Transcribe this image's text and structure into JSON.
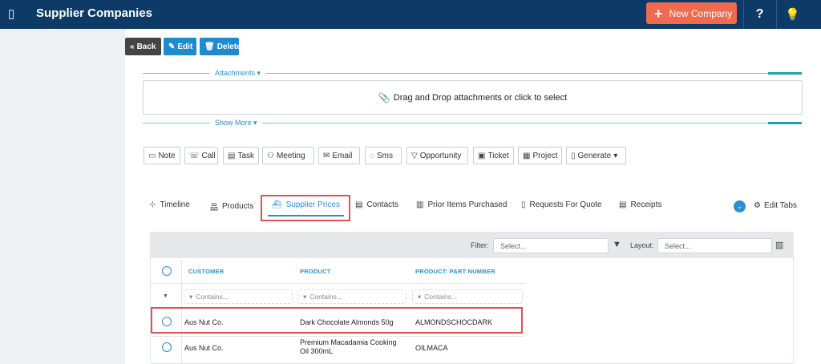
{
  "header": {
    "title": "Supplier Companies",
    "new_company_label": "New Company",
    "help_label": "?",
    "colors": {
      "bar": "#0d3a66",
      "new_company": "#f06a4f"
    }
  },
  "record_buttons": {
    "back": "Back",
    "edit": "Edit",
    "delete": "Delete"
  },
  "attachments": {
    "section_label": "Attachments",
    "dropzone_text": "Drag and Drop attachments or click to select",
    "show_more_label": "Show More"
  },
  "actions": [
    {
      "label": "Note",
      "icon": "note-icon"
    },
    {
      "label": "Call",
      "icon": "phone-icon"
    },
    {
      "label": "Task",
      "icon": "clipboard-icon"
    },
    {
      "label": "Meeting",
      "icon": "users-icon"
    },
    {
      "label": "Email",
      "icon": "email-icon"
    },
    {
      "label": "Sms",
      "icon": "chat-icon"
    },
    {
      "label": "Opportunity",
      "icon": "filter-icon"
    },
    {
      "label": "Ticket",
      "icon": "ticket-icon"
    },
    {
      "label": "Project",
      "icon": "project-icon"
    },
    {
      "label": "Generate",
      "icon": "document-icon"
    }
  ],
  "tabs": {
    "items": [
      "Timeline",
      "Products",
      "Supplier Prices",
      "Contacts",
      "Prior Items Purchased",
      "Requests For Quote",
      "Receipts"
    ],
    "active": "Supplier Prices",
    "edit_tabs_label": "Edit Tabs"
  },
  "grid": {
    "filter_label": "Filter:",
    "filter_placeholder": "Select...",
    "layout_label": "Layout:",
    "layout_placeholder": "Select...",
    "columns": [
      "CUSTOMER",
      "PRODUCT",
      "PRODUCT: PART NUMBER"
    ],
    "column_filter_placeholder": "Contains...",
    "rows": [
      {
        "customer": "Aus Nut Co.",
        "product": "Dark Chocolate Almonds 50g",
        "part_number": "ALMONDSCHOCDARK"
      },
      {
        "customer": "Aus Nut Co.",
        "product": "Premium Macadamia Cooking Oil 300mL",
        "part_number": "OILMACA"
      }
    ]
  }
}
